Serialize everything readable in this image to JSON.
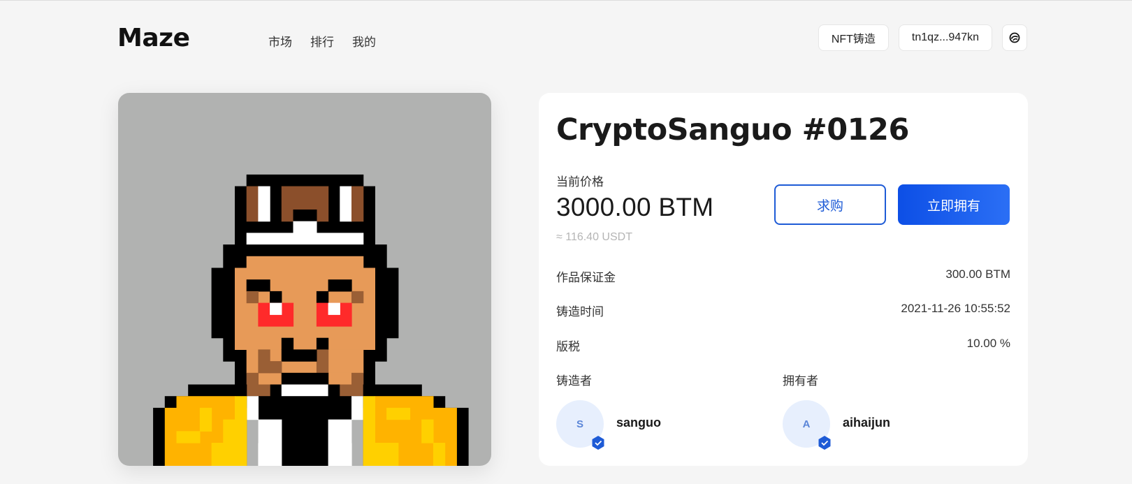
{
  "header": {
    "logo": "Maze",
    "nav": [
      "市场",
      "排行",
      "我的"
    ],
    "mint_button": "NFT铸造",
    "wallet_address": "tn1qz...947kn",
    "language_icon": "globe-swirl-icon"
  },
  "nft": {
    "title": "CryptoSanguo #0126",
    "image_description_icon": "pixel-warlord-avatar",
    "price_label": "当前价格",
    "price": "3000.00 BTM",
    "price_usdt": "≈ 116.40 USDT",
    "bid_button": "求购",
    "buy_button": "立即拥有",
    "details": [
      {
        "label": "作品保证金",
        "value": "300.00 BTM"
      },
      {
        "label": "铸造时间",
        "value": "2021-11-26 10:55:52"
      },
      {
        "label": "版税",
        "value": "10.00 %"
      }
    ],
    "creator": {
      "label": "铸造者",
      "initial": "S",
      "name": "sanguo"
    },
    "owner": {
      "label": "拥有者",
      "initial": "A",
      "name": "aihaijun"
    }
  },
  "colors": {
    "accent": "#1e5bd6",
    "button_gradient_start": "#0d4fe6",
    "button_gradient_end": "#2b6ff5",
    "art_background": "#b1b2b1"
  }
}
